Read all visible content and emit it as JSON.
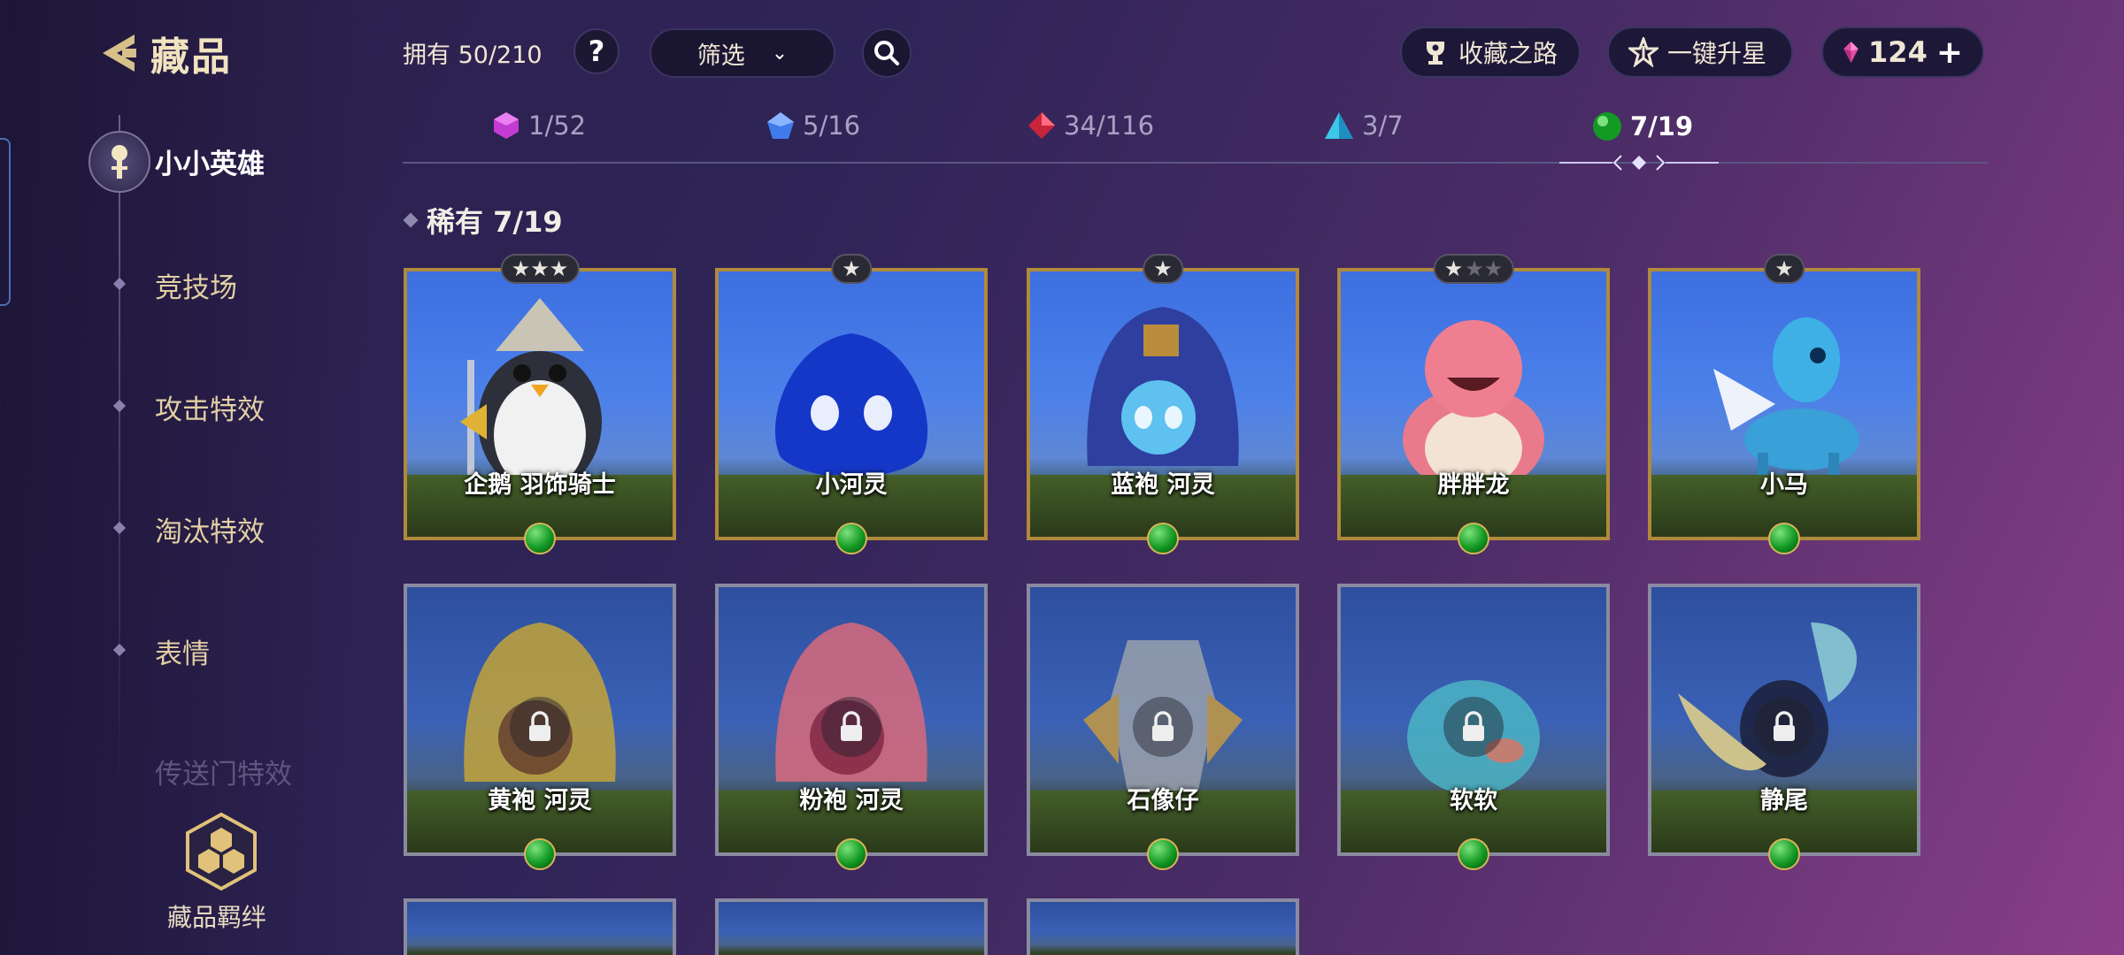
{
  "header": {
    "title": "藏品",
    "owned_text": "拥有 50/210",
    "help_label": "?",
    "filter_label": "筛选",
    "collection_road": "收藏之路",
    "one_key_upgrade": "一键升星",
    "currency": "124",
    "plus": "+"
  },
  "tabs": [
    {
      "label": "1/52",
      "gem": "purple-gem-icon",
      "color": "#c33bd0"
    },
    {
      "label": "5/16",
      "gem": "blue-gem-icon",
      "color": "#3f7bea"
    },
    {
      "label": "34/116",
      "gem": "red-gem-icon",
      "color": "#c8243c"
    },
    {
      "label": "3/7",
      "gem": "cyan-gem-icon",
      "color": "#3cc6e8"
    },
    {
      "label": "7/19",
      "gem": "green-gem-icon",
      "color": "#22a02c",
      "active": true
    }
  ],
  "section": {
    "title": "稀有 7/19"
  },
  "sidebar": {
    "items": [
      "小小英雄",
      "竞技场",
      "攻击特效",
      "淘汰特效",
      "表情"
    ],
    "faded_item": "传送门特效",
    "bond_label": "藏品羁绊"
  },
  "cards": [
    {
      "name": "企鹅 羽饰骑士",
      "stars": "★★★",
      "stars_off": "",
      "locked": false
    },
    {
      "name": "小河灵",
      "stars": "★",
      "stars_off": "",
      "locked": false
    },
    {
      "name": "蓝袍 河灵",
      "stars": "★",
      "stars_off": "",
      "locked": false
    },
    {
      "name": "胖胖龙",
      "stars": "★",
      "stars_off": "★★",
      "locked": false
    },
    {
      "name": "小马",
      "stars": "★",
      "stars_off": "",
      "locked": false
    },
    {
      "name": "黄袍 河灵",
      "locked": true
    },
    {
      "name": "粉袍 河灵",
      "locked": true
    },
    {
      "name": "石像仔",
      "locked": true
    },
    {
      "name": "软软",
      "locked": true
    },
    {
      "name": "静尾",
      "locked": true
    }
  ],
  "colors": {
    "accent_gold": "#b08a3c",
    "rarity_green": "#22a02c",
    "bg_dark": "#2a1f4a"
  }
}
